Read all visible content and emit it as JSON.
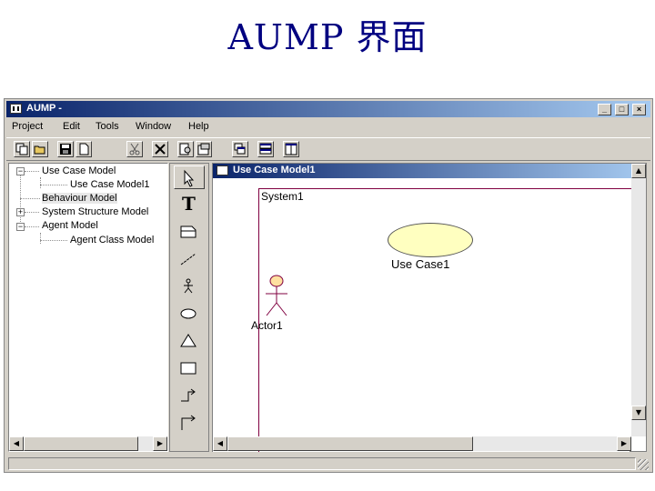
{
  "slide": {
    "title": "AUMP 界面"
  },
  "window": {
    "title": "AUMP -",
    "controls": {
      "minimize": "_",
      "maximize": "□",
      "close": "×"
    }
  },
  "menu": [
    "Project",
    "Edit",
    "Tools",
    "Window",
    "Help"
  ],
  "toolbar": {
    "icons": [
      "copy-icon",
      "open-icon",
      "save-icon",
      "new-icon",
      "cut-icon",
      "delete-icon",
      "preview-icon",
      "properties-icon",
      "cascade-icon",
      "tile-horizontal-icon",
      "tile-vertical-icon"
    ]
  },
  "tree": {
    "nodes": [
      {
        "label": "Use Case Model",
        "expander": "−"
      },
      {
        "label": "Use Case Model1"
      },
      {
        "label": "Behaviour Model"
      },
      {
        "label": "System Structure Model",
        "expander": "+"
      },
      {
        "label": "Agent Model",
        "expander": "−"
      },
      {
        "label": "Agent Class Model"
      }
    ]
  },
  "palette": {
    "tools": [
      "select-arrow-icon",
      "text-tool-icon",
      "note-icon",
      "association-line-icon",
      "actor-icon",
      "usecase-ellipse-icon",
      "triangle-icon",
      "rectangle-icon",
      "step-connector-icon",
      "corner-connector-icon"
    ],
    "text_tool_glyph": "T"
  },
  "document": {
    "title": "Use Case Model1",
    "system_label": "System1",
    "usecase_label": "Use Case1",
    "actor_label": "Actor1",
    "colors": {
      "system_border": "#800040",
      "usecase_fill": "#ffffc0",
      "actor_fill": "#ffe0a0",
      "actor_stroke": "#800040"
    }
  },
  "scroll": {
    "up": "▲",
    "down": "▼",
    "left": "◀",
    "right": "▶"
  }
}
